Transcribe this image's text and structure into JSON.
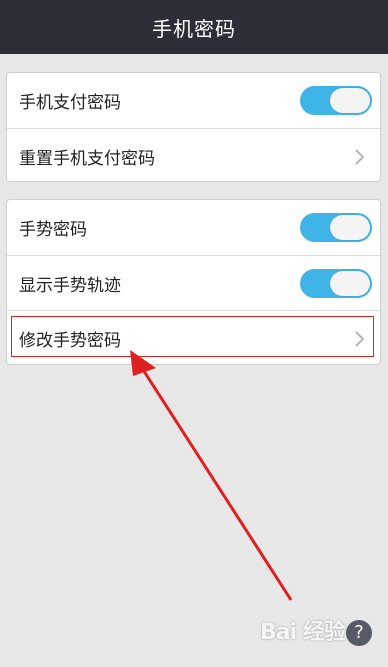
{
  "header": {
    "title": "手机密码"
  },
  "group1": {
    "rows": [
      {
        "label": "手机支付密码",
        "control": "toggle",
        "state": "on"
      },
      {
        "label": "重置手机支付密码",
        "control": "chevron"
      }
    ]
  },
  "group2": {
    "rows": [
      {
        "label": "手势密码",
        "control": "toggle",
        "state": "on"
      },
      {
        "label": "显示手势轨迹",
        "control": "toggle",
        "state": "on"
      },
      {
        "label": "修改手势密码",
        "control": "chevron",
        "highlighted": true
      }
    ]
  },
  "watermark": {
    "text": "Bai 经验"
  },
  "help": {
    "glyph": "?"
  },
  "colors": {
    "header_bg": "#2c2f37",
    "toggle_on": "#3fb4e6",
    "highlight": "#d32424",
    "background": "#e7e7e7"
  }
}
